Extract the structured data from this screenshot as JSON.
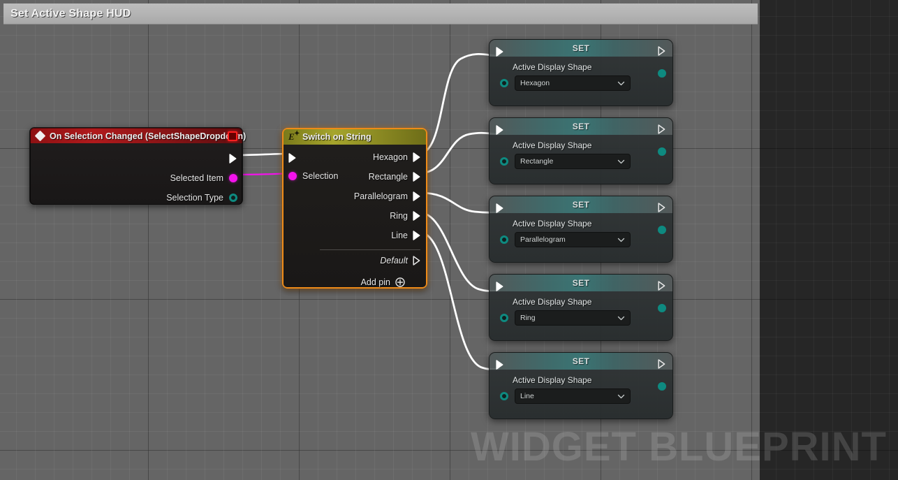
{
  "window": {
    "title": "Set Active Shape HUD"
  },
  "canvas": {
    "watermark": "WIDGET BLUEPRINT",
    "background_color": "#656565",
    "grid_line_color": "#747474",
    "major_grid_color": "#2e2e2e"
  },
  "nodes": {
    "event": {
      "title": "On Selection Changed (SelectShapeDropdown)",
      "header_color": "#a9191b",
      "icon": "event-diamond-icon",
      "stop_button": "stop-recording-button",
      "pins": [
        {
          "name": "exec-out",
          "label": "",
          "type": "exec",
          "color": "#ffffff"
        },
        {
          "name": "Selected Item",
          "label": "Selected Item",
          "type": "string",
          "color": "#f412ec"
        },
        {
          "name": "Selection Type",
          "label": "Selection Type",
          "type": "enum",
          "color": "#0e8a80"
        }
      ]
    },
    "switch": {
      "title": "Switch on String",
      "header_color": "#a6a52c",
      "selected": true,
      "selection_color": "#ef8b18",
      "input_pins": [
        {
          "label": "",
          "type": "exec",
          "color": "#ffffff"
        },
        {
          "label": "Selection",
          "type": "string",
          "color": "#f412ec"
        }
      ],
      "output_pins": [
        {
          "label": "Hexagon",
          "type": "exec",
          "connected": true
        },
        {
          "label": "Rectangle",
          "type": "exec",
          "connected": true
        },
        {
          "label": "Parallelogram",
          "type": "exec",
          "connected": true
        },
        {
          "label": "Ring",
          "type": "exec",
          "connected": true
        },
        {
          "label": "Line",
          "type": "exec",
          "connected": true
        },
        {
          "label": "Default",
          "type": "exec",
          "connected": false
        }
      ],
      "add_pin_label": "Add pin"
    },
    "setters": [
      {
        "title": "SET",
        "property_label": "Active Display Shape",
        "value": "Hexagon",
        "header_color": "#3f9694",
        "value_pin_color": "#0e8a80"
      },
      {
        "title": "SET",
        "property_label": "Active Display Shape",
        "value": "Rectangle",
        "header_color": "#3f9694",
        "value_pin_color": "#0e8a80"
      },
      {
        "title": "SET",
        "property_label": "Active Display Shape",
        "value": "Parallelogram",
        "header_color": "#3f9694",
        "value_pin_color": "#0e8a80"
      },
      {
        "title": "SET",
        "property_label": "Active Display Shape",
        "value": "Ring",
        "header_color": "#3f9694",
        "value_pin_color": "#0e8a80"
      },
      {
        "title": "SET",
        "property_label": "Active Display Shape",
        "value": "Line",
        "header_color": "#3f9694",
        "value_pin_color": "#0e8a80"
      }
    ]
  },
  "wires": [
    {
      "from": "event.exec-out",
      "to": "switch.exec-in",
      "color": "#ffffff",
      "type": "exec"
    },
    {
      "from": "event.Selected Item",
      "to": "switch.Selection",
      "color": "#f412ec",
      "type": "data"
    },
    {
      "from": "switch.Hexagon",
      "to": "setter-0.exec-in",
      "color": "#ffffff",
      "type": "exec"
    },
    {
      "from": "switch.Rectangle",
      "to": "setter-1.exec-in",
      "color": "#ffffff",
      "type": "exec"
    },
    {
      "from": "switch.Parallelogram",
      "to": "setter-2.exec-in",
      "color": "#ffffff",
      "type": "exec"
    },
    {
      "from": "switch.Ring",
      "to": "setter-3.exec-in",
      "color": "#ffffff",
      "type": "exec"
    },
    {
      "from": "switch.Line",
      "to": "setter-4.exec-in",
      "color": "#ffffff",
      "type": "exec"
    }
  ]
}
